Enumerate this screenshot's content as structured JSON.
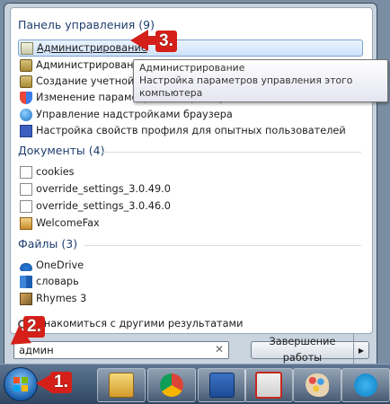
{
  "control_panel": {
    "header": "Панель управления (9)",
    "items": [
      {
        "label": "Администрирование",
        "icon": "admin-tools-icon"
      },
      {
        "label": "Администрирование учетных записей Windows",
        "icon": "user-accounts-icon"
      },
      {
        "label": "Создание учетной записи пользователя",
        "icon": "user-accounts-icon"
      },
      {
        "label": "Изменение параметров контроля учетных записей",
        "icon": "uac-shield-icon"
      },
      {
        "label": "Управление надстройками браузера",
        "icon": "browser-globe-icon"
      },
      {
        "label": "Настройка свойств профиля для опытных пользователей",
        "icon": "profile-check-icon"
      }
    ]
  },
  "tooltip": {
    "title": "Администрирование",
    "description": "Настройка параметров управления этого компьютера"
  },
  "documents": {
    "header": "Документы (4)",
    "items": [
      {
        "label": "cookies",
        "icon": "document-icon"
      },
      {
        "label": "override_settings_3.0.49.0",
        "icon": "document-icon"
      },
      {
        "label": "override_settings_3.0.46.0",
        "icon": "document-icon"
      },
      {
        "label": "WelcomeFax",
        "icon": "fax-icon"
      }
    ]
  },
  "files": {
    "header": "Файлы (3)",
    "items": [
      {
        "label": "OneDrive",
        "icon": "onedrive-cloud-icon"
      },
      {
        "label": "словарь",
        "icon": "book-icon"
      },
      {
        "label": "Rhymes 3",
        "icon": "package-icon"
      }
    ]
  },
  "more_results": "Ознакомиться с другими результатами",
  "search": {
    "value": "админ"
  },
  "shutdown": {
    "label": "Завершение работы"
  },
  "annotations": {
    "step1": "1.",
    "step2": "2.",
    "step3": "3."
  },
  "accent_color": "#d42018"
}
